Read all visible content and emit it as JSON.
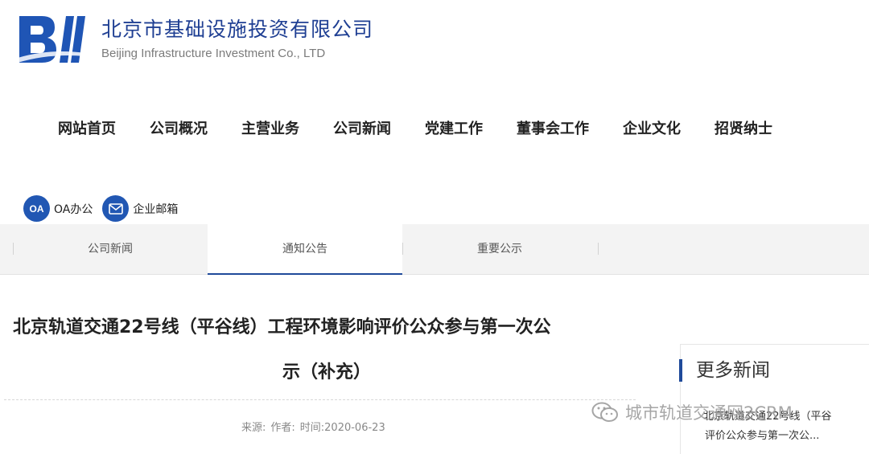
{
  "header": {
    "logo_mark": "BII",
    "company_cn": "北京市基础设施投资有限公司",
    "company_en": "Beijing Infrastructure Investment Co., LTD",
    "brand_color": "#1f3f93"
  },
  "main_nav": {
    "items": [
      {
        "label": "网站首页"
      },
      {
        "label": "公司概况"
      },
      {
        "label": "主营业务"
      },
      {
        "label": "公司新闻"
      },
      {
        "label": "党建工作"
      },
      {
        "label": "董事会工作"
      },
      {
        "label": "企业文化"
      },
      {
        "label": "招贤纳士"
      }
    ]
  },
  "quick_links": {
    "oa_icon": "OA",
    "oa_label": "OA办公",
    "mail_icon": "mail-icon",
    "mail_label": "企业邮箱"
  },
  "sub_nav": {
    "tabs": [
      {
        "label": "公司新闻",
        "active": false
      },
      {
        "label": "通知公告",
        "active": true
      },
      {
        "label": "重要公示",
        "active": false
      }
    ],
    "active_color": "#1f4a9a"
  },
  "article": {
    "title_line1": "北京轨道交通22号线（平谷线）工程环境影响评价公众参与第一次公",
    "title_line2": "示（补充）",
    "source_label": "来源:",
    "author_label": "作者:",
    "time_label": "时间:2020-06-23"
  },
  "sidebar": {
    "title": "更多新闻",
    "news_line1": "北京轨道交通22号线（平谷",
    "news_line2": "评价公众参与第一次公..."
  },
  "watermark": {
    "icon": "wechat-icon",
    "text": "城市轨道交通网2CRM"
  }
}
